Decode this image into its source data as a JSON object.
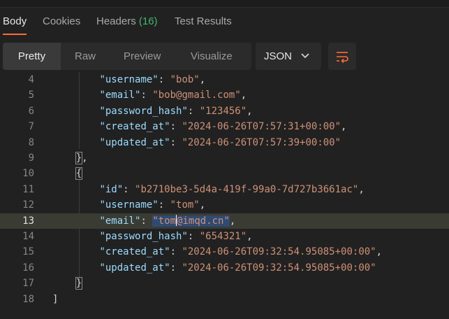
{
  "tabs": [
    {
      "label": "Body"
    },
    {
      "label": "Cookies"
    },
    {
      "label": "Headers",
      "count": "(16)"
    },
    {
      "label": "Test Results"
    }
  ],
  "view_modes": [
    "Pretty",
    "Raw",
    "Preview",
    "Visualize"
  ],
  "format": "JSON",
  "icons": {
    "format_dropdown": "chevron-down-icon",
    "wrap": "wrap-lines-icon"
  },
  "colors": {
    "accent": "#ff6c37",
    "key": "#9cdcfe",
    "string": "#ce9178",
    "count": "#43b670"
  },
  "code": {
    "lines": [
      {
        "n": "4",
        "indent": "        ",
        "key": "\"username\"",
        "value": "\"bob\"",
        "end": ","
      },
      {
        "n": "5",
        "indent": "        ",
        "key": "\"email\"",
        "value": "\"bob@gmail.com\"",
        "end": ","
      },
      {
        "n": "6",
        "indent": "        ",
        "key": "\"password_hash\"",
        "value": "\"123456\"",
        "end": ","
      },
      {
        "n": "7",
        "indent": "        ",
        "key": "\"created_at\"",
        "value": "\"2024-06-26T07:57:31+00:00\"",
        "end": ","
      },
      {
        "n": "8",
        "indent": "        ",
        "key": "\"updated_at\"",
        "value": "\"2024-06-26T07:57:39+00:00\"",
        "end": ""
      },
      {
        "n": "9",
        "indent": "    ",
        "punct": "},"
      },
      {
        "n": "10",
        "indent": "    ",
        "punct": "{"
      },
      {
        "n": "11",
        "indent": "        ",
        "key": "\"id\"",
        "value": "\"b2710be3-5d4a-419f-99a0-7d727b3661ac\"",
        "end": ","
      },
      {
        "n": "12",
        "indent": "        ",
        "key": "\"username\"",
        "value": "\"tom\"",
        "end": ","
      },
      {
        "n": "13",
        "indent": "        ",
        "key": "\"email\"",
        "value": "\"tom@imqd.cn\"",
        "end": ",",
        "current": true
      },
      {
        "n": "14",
        "indent": "        ",
        "key": "\"password_hash\"",
        "value": "\"654321\"",
        "end": ","
      },
      {
        "n": "15",
        "indent": "        ",
        "key": "\"created_at\"",
        "value": "\"2024-06-26T09:32:54.95085+00:00\"",
        "end": ","
      },
      {
        "n": "16",
        "indent": "        ",
        "key": "\"updated_at\"",
        "value": "\"2024-06-26T09:32:54.95085+00:00\"",
        "end": ""
      },
      {
        "n": "17",
        "indent": "    ",
        "punct": "}"
      },
      {
        "n": "18",
        "indent": "",
        "punct": "]"
      }
    ]
  }
}
